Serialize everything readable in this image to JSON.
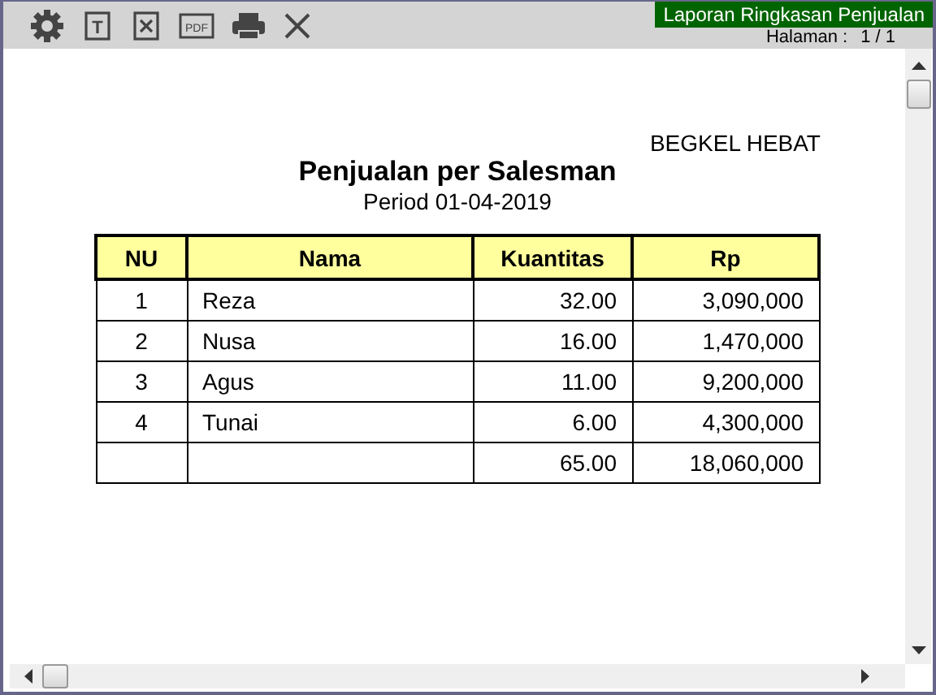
{
  "toolbar": [
    {
      "kind": "settings"
    },
    {
      "kind": "text",
      "glyph": "T"
    },
    {
      "kind": "excel"
    },
    {
      "kind": "pdf",
      "glyph": "PDF"
    },
    {
      "kind": "print"
    },
    {
      "kind": "close"
    }
  ],
  "report_name": "Laporan Ringkasan Penjualan",
  "page_indicator": {
    "label": "Halaman :",
    "value": "1 / 1"
  },
  "company": "BEGKEL HEBAT",
  "title": "Penjualan per Salesman",
  "period": "Period 01-04-2019",
  "table": {
    "columns": [
      "NU",
      "Nama",
      "Kuantitas",
      "Rp"
    ],
    "rows": [
      [
        "1",
        "Reza",
        "32.00",
        "3,090,000"
      ],
      [
        "2",
        "Nusa",
        "16.00",
        "1,470,000"
      ],
      [
        "3",
        "Agus",
        "11.00",
        "9,200,000"
      ],
      [
        "4",
        "Tunai",
        "6.00",
        "4,300,000"
      ]
    ],
    "total": {
      "kuantitas": "65.00",
      "rp": "18,060,000"
    }
  }
}
